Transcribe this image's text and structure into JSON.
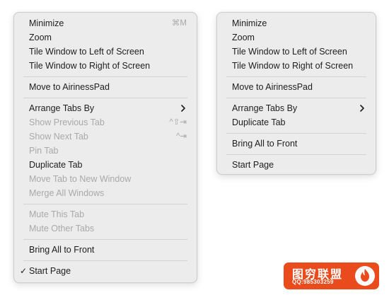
{
  "left_menu": {
    "minimize": "Minimize",
    "minimize_shortcut": "⌘M",
    "zoom": "Zoom",
    "tile_left": "Tile Window to Left of Screen",
    "tile_right": "Tile Window to Right of Screen",
    "move_to": "Move to AirinessPad",
    "arrange_tabs": "Arrange Tabs By",
    "show_previous_tab": "Show Previous Tab",
    "show_previous_tab_shortcut": "^⇧⇥",
    "show_next_tab": "Show Next Tab",
    "show_next_tab_shortcut": "^⇥",
    "pin_tab": "Pin Tab",
    "duplicate_tab": "Duplicate Tab",
    "move_tab_new_window": "Move Tab to New Window",
    "merge_all_windows": "Merge All Windows",
    "mute_this_tab": "Mute This Tab",
    "mute_other_tabs": "Mute Other Tabs",
    "bring_all_front": "Bring All to Front",
    "start_page_check": "✓",
    "start_page": "Start Page"
  },
  "right_menu": {
    "minimize": "Minimize",
    "zoom": "Zoom",
    "tile_left": "Tile Window to Left of Screen",
    "tile_right": "Tile Window to Right of Screen",
    "move_to": "Move to AirinessPad",
    "arrange_tabs": "Arrange Tabs By",
    "duplicate_tab": "Duplicate Tab",
    "bring_all_front": "Bring All to Front",
    "start_page": "Start Page"
  },
  "watermark": {
    "title": "图穷联盟",
    "subtitle": "QQ:985303259"
  },
  "colors": {
    "menu_background": "#ececec",
    "enabled_text": "#1d1d1d",
    "disabled_text": "#a9a9a9",
    "badge": "#ea4b1c"
  }
}
